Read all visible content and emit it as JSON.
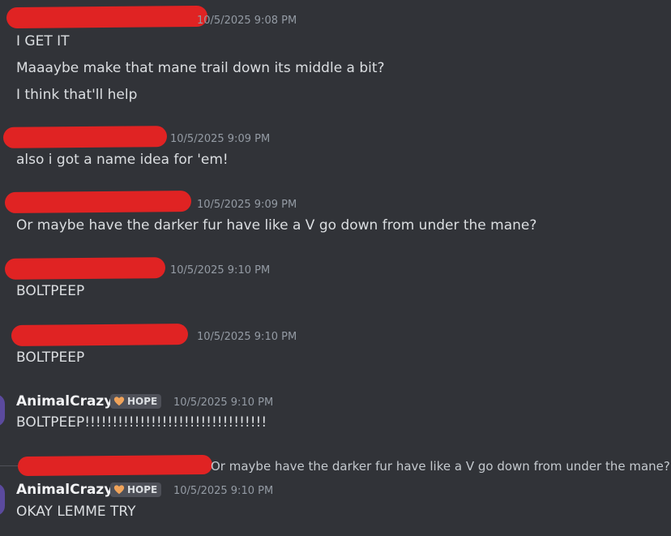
{
  "messages": [
    {
      "timestamp": "10/5/2025 9:08 PM",
      "lines": [
        "I GET IT",
        "Maaaybe make that mane trail down its middle a bit?",
        "I think that'll help"
      ]
    },
    {
      "timestamp": "10/5/2025 9:09 PM",
      "lines": [
        "also i got a name idea for 'em!"
      ]
    },
    {
      "timestamp": "10/5/2025 9:09 PM",
      "lines": [
        "Or maybe have the darker fur have like a V go down from under the mane?"
      ]
    },
    {
      "timestamp": "10/5/2025 9:10 PM",
      "lines": [
        "BOLTPEEP"
      ]
    },
    {
      "timestamp": "10/5/2025 9:10 PM",
      "lines": [
        "BOLTPEEP"
      ]
    },
    {
      "username": "AnimalCrazy",
      "tag": "HOPE",
      "tag_icon": "heart-icon",
      "tag_color": "#f0a35a",
      "timestamp": "10/5/2025 9:10 PM",
      "lines": [
        "BOLTPEEP!!!!!!!!!!!!!!!!!!!!!!!!!!!!!!!!!"
      ]
    },
    {
      "reply_preview": "Or maybe have the darker fur have like a V go down from under the mane?",
      "username": "AnimalCrazy",
      "tag": "HOPE",
      "tag_icon": "heart-icon",
      "tag_color": "#f0a35a",
      "timestamp": "10/5/2025 9:10 PM",
      "lines": [
        "OKAY LEMME TRY"
      ]
    }
  ],
  "colors": {
    "background": "#313338",
    "redaction": "#e02323",
    "timestamp": "#949ba4",
    "text": "#dbdee1"
  }
}
